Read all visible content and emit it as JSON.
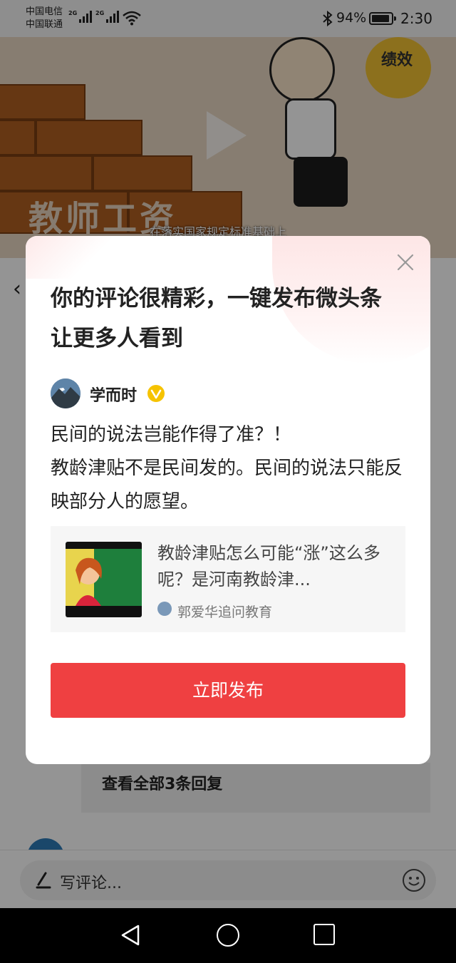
{
  "status_bar": {
    "carrier_1": "中国电信",
    "carrier_2": "中国联通",
    "network_1": "2G",
    "network_2": "2G",
    "battery": "94%",
    "battery_level": 0.94,
    "time": "2:30"
  },
  "video": {
    "overlay_title": "教师工资",
    "subtitle": "在落实国家规定标准基础上",
    "balloon_text": "绩效"
  },
  "background": {
    "view_replies": "查看全部3条回复",
    "comment_placeholder": "写评论..."
  },
  "dialog": {
    "title": "你的评论很精彩，一键发布微头条让更多人看到",
    "author_name": "学而时",
    "comment_line_1": "民间的说法岂能作得了准？！",
    "comment_line_2": "教龄津贴不是民间发的。民间的说法只能反映部分人的愿望。",
    "article": {
      "title": "教龄津贴怎么可能“涨”这么多呢？是河南教龄津...",
      "source": "郭爱华追问教育"
    },
    "publish_label": "立即发布"
  },
  "colors": {
    "primary_red": "#ef4041",
    "verified_gold": "#f6c300"
  }
}
